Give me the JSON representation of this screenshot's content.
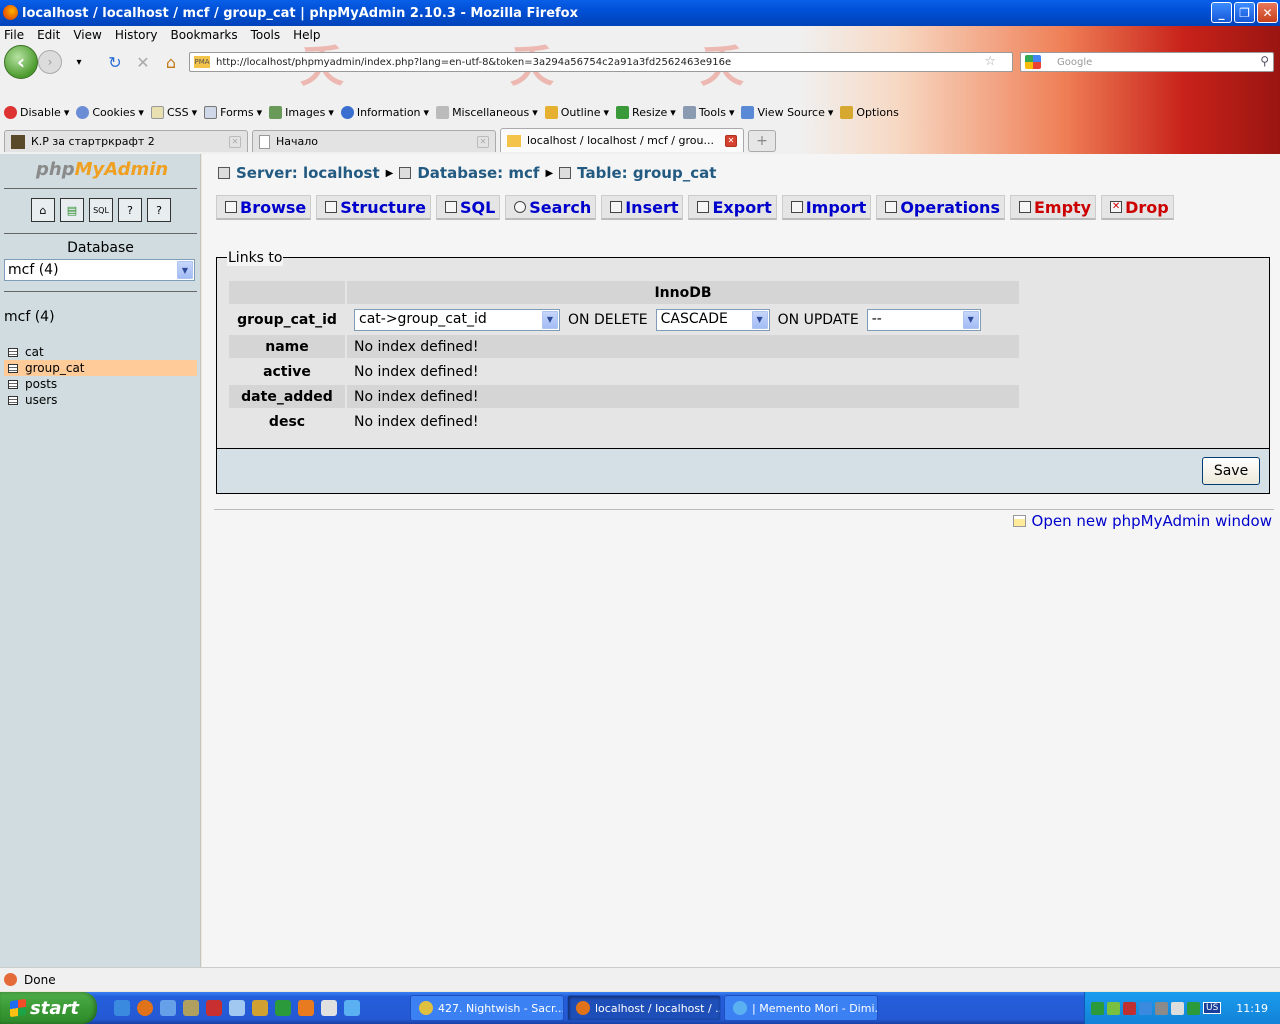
{
  "window": {
    "title": "localhost / localhost / mcf / group_cat | phpMyAdmin 2.10.3 - Mozilla Firefox"
  },
  "browser": {
    "menu": [
      "File",
      "Edit",
      "View",
      "History",
      "Bookmarks",
      "Tools",
      "Help"
    ],
    "url": "http://localhost/phpmyadmin/index.php?lang=en-utf-8&token=3a294a56754c2a91a3fd2562463e916e",
    "search_placeholder": "Google",
    "webdev_toolbar": [
      "Disable",
      "Cookies",
      "CSS",
      "Forms",
      "Images",
      "Information",
      "Miscellaneous",
      "Outline",
      "Resize",
      "Tools",
      "View Source",
      "Options"
    ],
    "tabs": [
      {
        "label": "К.Р за стартркрафт 2"
      },
      {
        "label": "Начало"
      },
      {
        "label": "localhost / localhost / mcf / grou..."
      }
    ],
    "status": "Done"
  },
  "sidebar": {
    "logo_php": "php",
    "logo_my": "MyAdmin",
    "database_label": "Database",
    "database_selected": "mcf (4)",
    "db_title": "mcf (4)",
    "tables": [
      "cat",
      "group_cat",
      "posts",
      "users"
    ],
    "active_table": "group_cat"
  },
  "main": {
    "breadcrumb": {
      "server": "Server: localhost",
      "database": "Database: mcf",
      "table": "Table: group_cat"
    },
    "tabs": [
      "Browse",
      "Structure",
      "SQL",
      "Search",
      "Insert",
      "Export",
      "Import",
      "Operations",
      "Empty",
      "Drop"
    ],
    "fieldset_legend": "Links to",
    "engine_header": "InnoDB",
    "fk_row": {
      "column": "group_cat_id",
      "reference": "cat->group_cat_id",
      "on_delete_label": "ON DELETE",
      "on_delete_value": "CASCADE",
      "on_update_label": "ON UPDATE",
      "on_update_value": "--"
    },
    "other_rows": [
      {
        "column": "name",
        "value": "No index defined!"
      },
      {
        "column": "active",
        "value": "No index defined!"
      },
      {
        "column": "date_added",
        "value": "No index defined!"
      },
      {
        "column": "desc",
        "value": "No index defined!"
      }
    ],
    "save_label": "Save",
    "new_window_link": "Open new phpMyAdmin window"
  },
  "taskbar": {
    "start_label": "start",
    "tasks": [
      {
        "label": "427. Nightwish - Sacr..."
      },
      {
        "label": "localhost / localhost / ..."
      },
      {
        "label": "| Memento Mori - Dimi..."
      }
    ],
    "active_task": 1,
    "lang": "US",
    "clock": "11:19"
  }
}
